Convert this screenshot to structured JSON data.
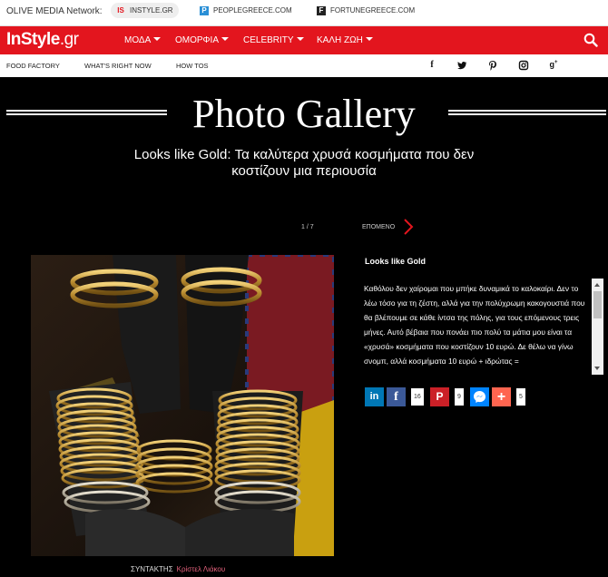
{
  "network": {
    "label": "OLIVE MEDIA Network:",
    "links": [
      {
        "label": "INSTYLE.GR",
        "icon": "instyle-logo-icon"
      },
      {
        "label": "PEOPLEGREECE.COM",
        "icon": "people-logo-icon"
      },
      {
        "label": "FORTUNEGREECE.COM",
        "icon": "fortune-logo-icon"
      }
    ]
  },
  "nav": {
    "logo_main": "InStyle",
    "logo_tld": ".gr",
    "items": [
      "ΜΟΔΑ",
      "ΟΜΟΡΦΙΑ",
      "CELEBRITY",
      "ΚΑΛΗ ΖΩΗ"
    ],
    "accent": "#e3151e"
  },
  "subnav": {
    "items": [
      "FOOD FACTORY",
      "WHAT'S RIGHT NOW",
      "HOW TOS"
    ],
    "social": [
      "facebook-icon",
      "twitter-icon",
      "pinterest-icon",
      "instagram-icon",
      "google-plus-icon"
    ]
  },
  "gallery": {
    "title": "Photo Gallery",
    "subtitle": "Looks like Gold: Τα καλύτερα χρυσά κοσμήματα που δεν κοστίζουν μια περιουσία",
    "counter": "1 / 7",
    "next_label": "ΕΠΟΜΕΝΟ",
    "credit_label": "ΣΥΝΤΑΚΤΗΣ",
    "credit_author": "Κρίστελ Λιάκου"
  },
  "article": {
    "title": "Looks like Gold",
    "body": "Καθόλου δεν χαίρομαι που μπήκε δυναμικά το καλοκαίρι. Δεν το λέω τόσο για τη ζέστη, αλλά για την πολύχρωμη κακογουστιά που θα βλέπουμε σε κάθε ίντσα της πόλης, για τους επόμενους τρεις μήνες. Αυτό βέβαια που πονάει πιο πολύ τα μάτια μου είναι τα «χρυσά» κοσμήματα που κοστίζουν 10 ευρώ. Δε θέλω να γίνω σνομπ, αλλά κοσμήματα 10 ευρώ + ιδρώτας ="
  },
  "share": {
    "facebook_count": "16",
    "pinterest_count": "9",
    "more_count": "5"
  }
}
